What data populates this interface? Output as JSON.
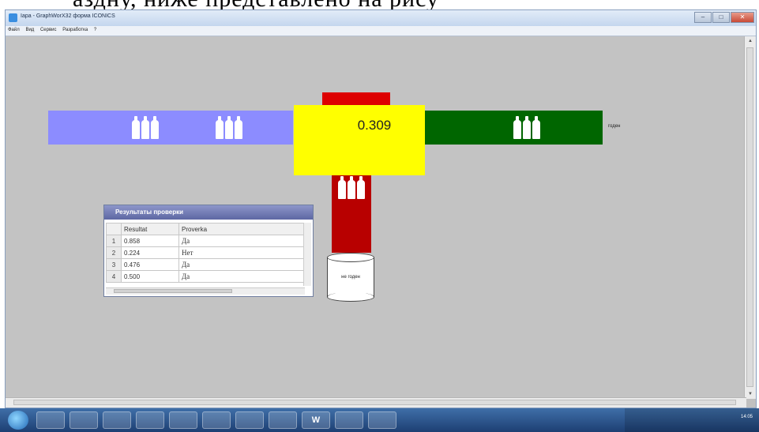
{
  "slide_fragment": "аздну, ниже представлено на рису",
  "window": {
    "title": "Iара - GraphWorX32 форма ICONICS",
    "controls": [
      "–",
      "□",
      "✕"
    ]
  },
  "menu": [
    "Файл",
    "Вид",
    "Сервис",
    "Разработка",
    "?"
  ],
  "simulation": {
    "value": "0.309",
    "right_label": "годен",
    "drum_label": "не годен",
    "colors": {
      "left_conveyor": "#8c8cff",
      "right_conveyor": "#006600",
      "gauge": "#ffff00",
      "reject_chute": "#b80000"
    }
  },
  "results": {
    "title": "Результаты проверки",
    "columns": [
      "",
      "Resultat",
      "Proverka"
    ],
    "rows": [
      {
        "n": "1",
        "result": "0.858",
        "check": "Да"
      },
      {
        "n": "2",
        "result": "0.224",
        "check": "Нет"
      },
      {
        "n": "3",
        "result": "0.476",
        "check": "Да"
      },
      {
        "n": "4",
        "result": "0.500",
        "check": "Да"
      }
    ]
  },
  "taskbar": {
    "items": [
      "ie-icon",
      "firefox-icon",
      "skype-icon",
      "app-icon",
      "viber-icon",
      "app-icon",
      "app-icon",
      "folder-icon",
      "W",
      "excel-icon",
      "calc-icon"
    ],
    "word_label": "W",
    "clock": "14:05"
  }
}
